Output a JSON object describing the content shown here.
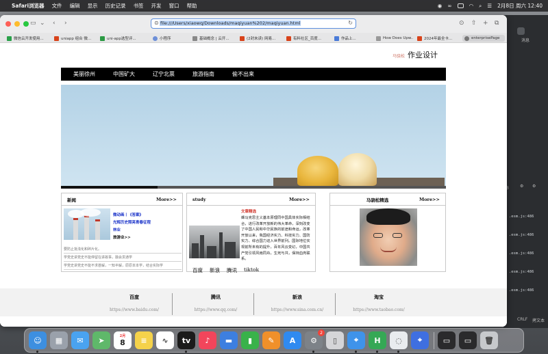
{
  "menubar": {
    "app_name": "Safari浏览器",
    "items": [
      "文件",
      "编辑",
      "显示",
      "历史记录",
      "书签",
      "开发",
      "窗口",
      "帮助"
    ],
    "datetime": "2月8日 周六 12:40"
  },
  "browser": {
    "url": "file:///Users/xiaowq/Downloads/maqiyuan%202/maqiyuan.html",
    "bookmarks": [
      {
        "label": "微信云开发使用...",
        "color": "#2aa14a"
      },
      {
        "label": "uniapp 组合 微...",
        "color": "#d8431b"
      },
      {
        "label": "uni-app选型评...",
        "color": "#2b9a44"
      },
      {
        "label": "小程序",
        "color": "#6d8fd8"
      },
      {
        "label": "基础概念 | 云开...",
        "color": "#888888"
      },
      {
        "label": "(2封未读) 网易...",
        "color": "#d8431b"
      },
      {
        "label": "有料社区_百度...",
        "color": "#d8431b"
      },
      {
        "label": "作品上...",
        "color": "#4a7bd8"
      },
      {
        "label": "How Does Upw...",
        "color": "#999999"
      },
      {
        "label": "2024年最全卡...",
        "color": "#d8431b"
      },
      {
        "label": "enterprisePage",
        "color": "#777777"
      }
    ]
  },
  "page": {
    "brand_name": "马骁松",
    "brand_title": "作业设计",
    "nav": [
      "美丽徐州",
      "中国矿大",
      "辽宁北票",
      "旅游指南",
      "偷不出来"
    ],
    "banner_progress": 0.25,
    "news": {
      "title": "新闻",
      "more": "More>>",
      "links": [
        "微动画丨《答案》",
        "光辉历史照亮青春征程",
        "林业",
        "旅游业>>"
      ],
      "items": [
        "要防止批浅化和碎片化。",
        "学党史讲党史不能停留在讲故事，融会贯通学",
        "学党史讲党史不能不求甚解，一知半解，原原本本学，结合实际学"
      ]
    },
    "study": {
      "title": "study",
      "more": "More>>",
      "article_title": "文章精选",
      "article_body": "蜂马克思主义基本原理同中国具体实际相结合，进行改革开放新的伟大革命，深刻改变了中国人民和中华民族的前途和命运，改革开放以来，我国经济实力、科技实力、国防实力、综合国力进入世界前列。国际地位实现前所未有的提升，百年风云变幻，中国共产党引领风雨同舟，生死与共，保持血肉联系。",
      "tabs": [
        "百度",
        "新浪",
        "腾讯",
        "tiktok"
      ]
    },
    "photo_panel": {
      "title": "马骁松精选",
      "more": "More>>"
    },
    "footer": [
      {
        "name": "百度",
        "url": "https://www.baidu.com/"
      },
      {
        "name": "腾讯",
        "url": "https://www.qq.com/"
      },
      {
        "name": "新浪",
        "url": "https://www.sina.com.cn/"
      },
      {
        "name": "淘宝",
        "url": "https://www.taobao.com/"
      }
    ]
  },
  "bg_window": {
    "labels": [
      "消息",
      "3",
      "CRLF",
      "拷文本"
    ],
    "log_lines": [
      ".esm.js:486",
      ".esm.js:486",
      ".esm.js:486",
      ".esm.js:486",
      ".esm.js:486"
    ]
  },
  "dock": {
    "calendar_month": "2月",
    "calendar_day": "8",
    "settings_badge": "2",
    "apps": [
      {
        "icon": "finder-icon",
        "color": "#3d8fe0"
      },
      {
        "icon": "launchpad-icon",
        "color": "#9aa1ab"
      },
      {
        "icon": "mail-icon",
        "color": "#4aa3f0"
      },
      {
        "icon": "maps-icon",
        "color": "#5fb86a"
      },
      {
        "icon": "calendar-icon",
        "color": "#ffffff"
      },
      {
        "icon": "notes-icon",
        "color": "#f5d24a"
      },
      {
        "icon": "freeform-icon",
        "color": "#ffffff"
      },
      {
        "icon": "appletv-icon",
        "color": "#1b1b1b"
      },
      {
        "icon": "music-icon",
        "color": "#f2455b"
      },
      {
        "icon": "keynote-icon",
        "color": "#3d7fe0"
      },
      {
        "icon": "numbers-icon",
        "color": "#39b24a"
      },
      {
        "icon": "pages-icon",
        "color": "#f0902a"
      },
      {
        "icon": "appstore-icon",
        "color": "#2f8af0"
      },
      {
        "icon": "settings-icon",
        "color": "#7d8288"
      },
      {
        "icon": "iphone-mirroring-icon",
        "color": "#d5d5d8"
      },
      {
        "icon": "safari-icon",
        "color": "#3f93ea"
      },
      {
        "icon": "hbuilder-icon",
        "color": "#35a855"
      },
      {
        "icon": "wechat-devtools-icon",
        "color": "#e9ecef"
      },
      {
        "icon": "safari-tech-preview-icon",
        "color": "#3f6fe0"
      },
      {
        "icon": "window-thumb-1",
        "color": "#2a2a2c"
      },
      {
        "icon": "window-thumb-2",
        "color": "#2a2a2c"
      },
      {
        "icon": "trash-icon",
        "color": "#c7c9cc"
      }
    ]
  },
  "colors": {
    "nav_bg": "#000000",
    "accent_blue": "#1a33c9",
    "article_red": "#d0352b",
    "brand_red": "#d07a6c"
  }
}
